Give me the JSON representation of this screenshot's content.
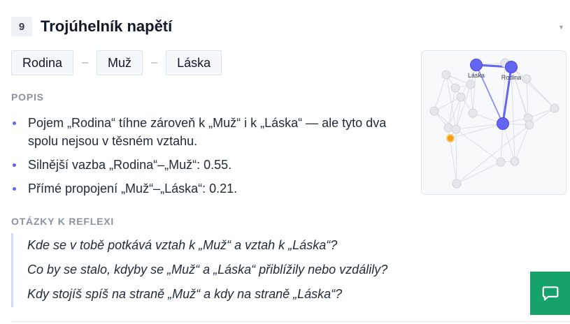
{
  "section": {
    "number": "9",
    "title": "Trojúhelník napětí"
  },
  "chips": [
    "Rodina",
    "Muž",
    "Láska"
  ],
  "chip_separator": "–",
  "popis": {
    "label": "POPIS",
    "items": [
      "Pojem „Rodina“ tíhne zároveň k „Muž“ i k „Láska“ — ale tyto dva spolu nejsou v těsném vztahu.",
      "Silnější vazba „Rodina“–„Muž“: 0.55.",
      "Přímé propojení „Muž“–„Láska“: 0.21."
    ]
  },
  "reflexe": {
    "label": "OTÁZKY K REFLEXI",
    "questions": [
      "Kde se v tobě potkává vztah k „Muž“ a vztah k „Láska“?",
      "Co by se stalo, kdyby se „Muž“ a „Láska“ přiblížily nebo vzdálily?",
      "Kdy stojíš spíš na straně „Muž“ a kdy na straně „Láska“?"
    ]
  },
  "graph": {
    "labels": {
      "laska": "Láska",
      "rodina": "Rodina"
    },
    "colors": {
      "highlight": "#6366f1",
      "accent": "#f59e0b",
      "node": "#e5e7eb",
      "edge": "#dcdfe5"
    },
    "strengths": {
      "rodina_muz": 0.55,
      "muz_laska": 0.21
    }
  },
  "icons": {
    "caret": "caret-down-icon",
    "chat": "chat-icon"
  },
  "colors": {
    "chat_button": "#16a36a"
  }
}
